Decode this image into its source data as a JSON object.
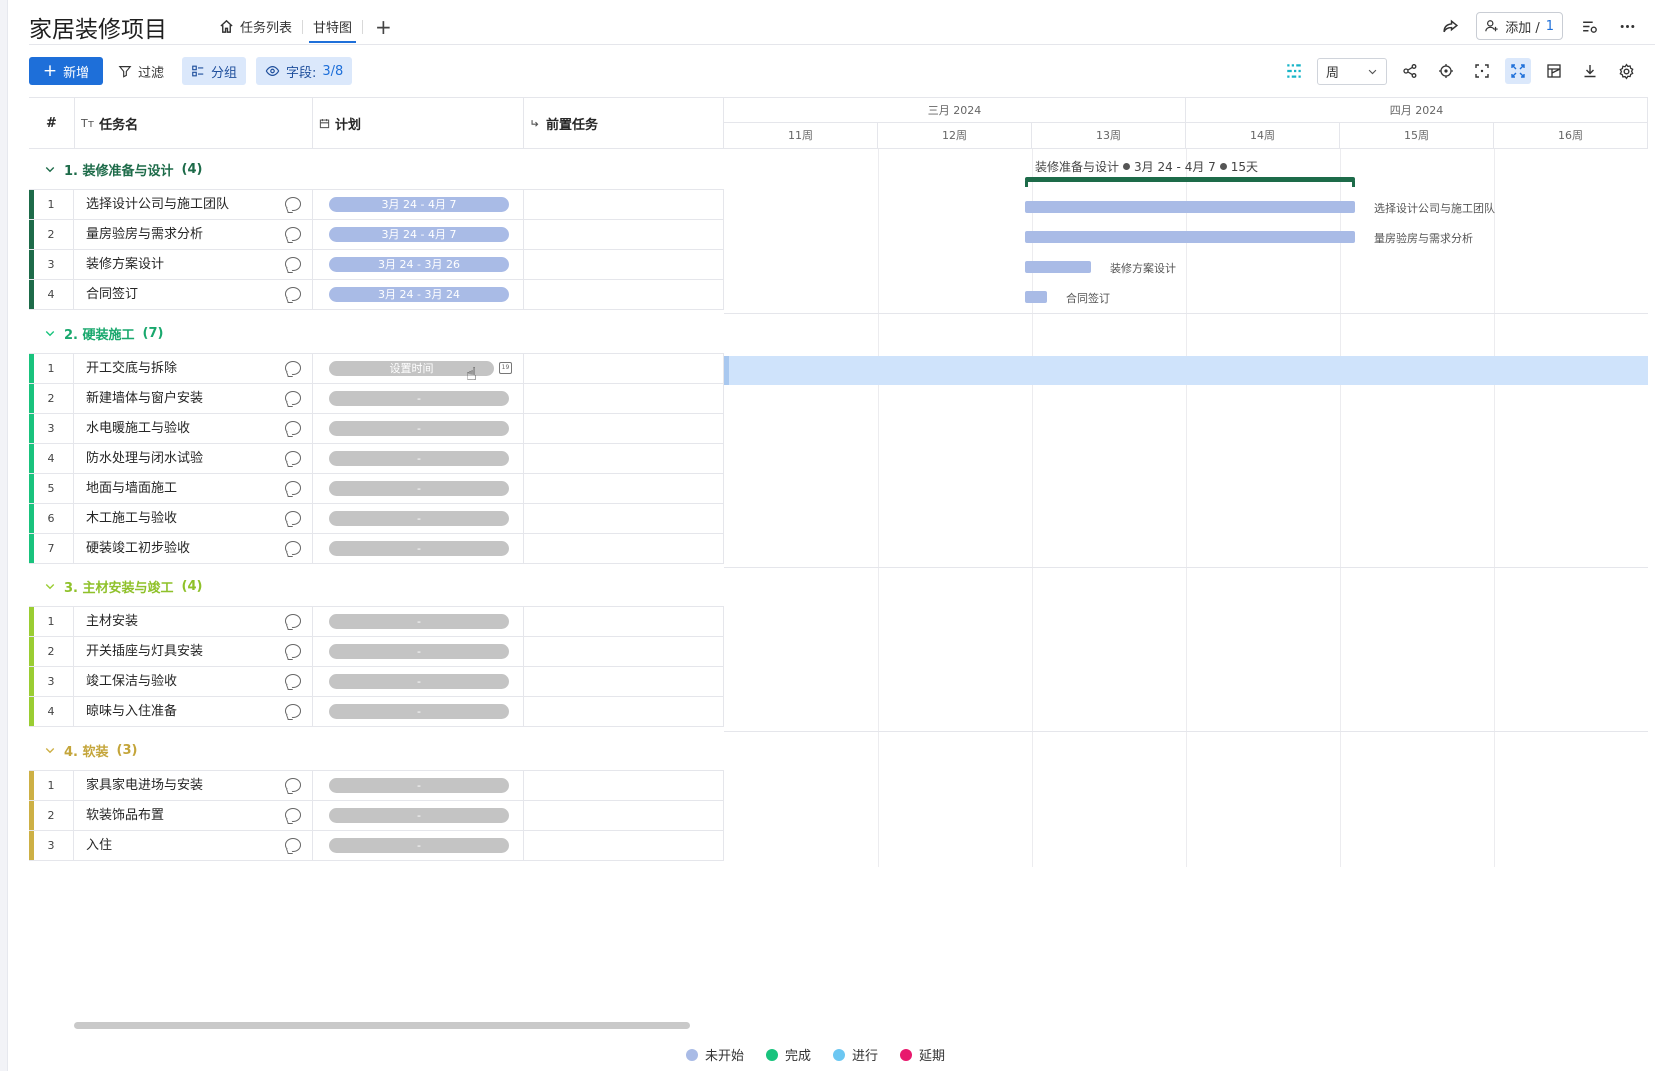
{
  "app": {
    "title": "家居装修项目"
  },
  "tabs": [
    {
      "label": "任务列表",
      "icon": "home-icon"
    },
    {
      "label": "甘特图",
      "active": true
    }
  ],
  "header": {
    "add_member_label": "添加 /",
    "add_member_count": "1"
  },
  "toolbar": {
    "new_label": "新增",
    "filter_label": "过滤",
    "group_label": "分组",
    "fields_label": "字段:",
    "fields_count": "3/8",
    "view_select": "周"
  },
  "columns": {
    "index": "#",
    "name": "任务名",
    "plan": "计划",
    "predecessor": "前置任务"
  },
  "timeline": {
    "months": [
      "三月 2024",
      "四月 2024"
    ],
    "weeks": [
      "11周",
      "12周",
      "13周",
      "14周",
      "15周",
      "16周"
    ]
  },
  "groups": [
    {
      "title": "1. 装修准备与设计",
      "count": "(4)",
      "color": "#1d6b49",
      "tasks": [
        {
          "num": "1",
          "name": "选择设计公司与施工团队",
          "plan": "3月 24 - 4月 7"
        },
        {
          "num": "2",
          "name": "量房验房与需求分析",
          "plan": "3月 24 - 4月 7"
        },
        {
          "num": "3",
          "name": "装修方案设计",
          "plan": "3月 24 - 3月 26"
        },
        {
          "num": "4",
          "name": "合同签订",
          "plan": "3月 24 - 3月 24"
        }
      ]
    },
    {
      "title": "2. 硬装施工",
      "count": "(7)",
      "color": "#19c37d",
      "tasks": [
        {
          "num": "1",
          "name": "开工交底与拆除",
          "plan": "设置时间"
        },
        {
          "num": "2",
          "name": "新建墙体与窗户安装",
          "plan": "-"
        },
        {
          "num": "3",
          "name": "水电暖施工与验收",
          "plan": "-"
        },
        {
          "num": "4",
          "name": "防水处理与闭水试验",
          "plan": "-"
        },
        {
          "num": "5",
          "name": "地面与墙面施工",
          "plan": "-"
        },
        {
          "num": "6",
          "name": "木工施工与验收",
          "plan": "-"
        },
        {
          "num": "7",
          "name": "硬装竣工初步验收",
          "plan": "-"
        }
      ]
    },
    {
      "title": "3. 主材安装与竣工",
      "count": "(4)",
      "color": "#9acd32",
      "tasks": [
        {
          "num": "1",
          "name": "主材安装",
          "plan": "-"
        },
        {
          "num": "2",
          "name": "开关插座与灯具安装",
          "plan": "-"
        },
        {
          "num": "3",
          "name": "竣工保洁与验收",
          "plan": "-"
        },
        {
          "num": "4",
          "name": "晾味与入住准备",
          "plan": "-"
        }
      ]
    },
    {
      "title": "4. 软装",
      "count": "(3)",
      "color": "#cdb045",
      "tasks": [
        {
          "num": "1",
          "name": "家具家电进场与安装",
          "plan": "-"
        },
        {
          "num": "2",
          "name": "软装饰品布置",
          "plan": "-"
        },
        {
          "num": "3",
          "name": "入住",
          "plan": "-"
        }
      ]
    }
  ],
  "gantt": {
    "summary": {
      "name": "装修准备与设计",
      "range": "3月 24 - 4月 7",
      "duration": "15天"
    },
    "bar_labels": [
      "选择设计公司与施工团队",
      "量房验房与需求分析",
      "装修方案设计",
      "合同签订"
    ]
  },
  "legend": [
    {
      "label": "未开始",
      "color": "#a9bbe6"
    },
    {
      "label": "完成",
      "color": "#19c37d"
    },
    {
      "label": "进行",
      "color": "#6cc7f2"
    },
    {
      "label": "延期",
      "color": "#e8196d"
    }
  ]
}
